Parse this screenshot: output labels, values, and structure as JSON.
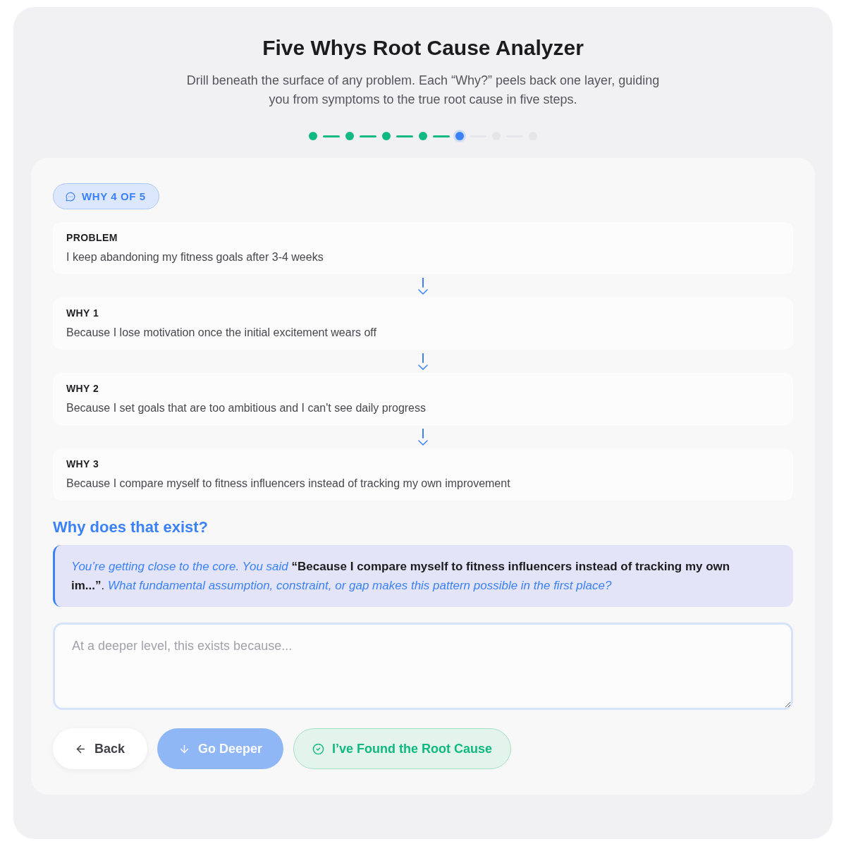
{
  "header": {
    "title": "Five Whys Root Cause Analyzer",
    "subtitle": "Drill beneath the surface of any problem. Each “Why?” peels back one layer, guiding you from symptoms to the true root cause in five steps."
  },
  "progress": {
    "steps": [
      {
        "completed": true,
        "current": false
      },
      {
        "completed": true,
        "current": false
      },
      {
        "completed": true,
        "current": false
      },
      {
        "completed": true,
        "current": false
      },
      {
        "completed": false,
        "current": true
      },
      {
        "completed": false,
        "current": false
      },
      {
        "completed": false,
        "current": false
      }
    ]
  },
  "badge": {
    "label": "WHY 4 OF 5"
  },
  "chain": [
    {
      "label": "PROBLEM",
      "text": "I keep abandoning my fitness goals after 3-4 weeks"
    },
    {
      "label": "WHY 1",
      "text": "Because I lose motivation once the initial excitement wears off"
    },
    {
      "label": "WHY 2",
      "text": "Because I set goals that are too ambitious and I can't see daily progress"
    },
    {
      "label": "WHY 3",
      "text": "Because I compare myself to fitness influencers instead of tracking my own improvement"
    }
  ],
  "question": {
    "heading": "Why does that exist?",
    "prompt": "*You’re getting close to the core. You said* **“Because I compare myself to fitness influencers instead of tracking my own im...”**. *What fundamental assumption, constraint, or gap makes this pattern possible in the first place?*"
  },
  "answer": {
    "placeholder": "At a deeper level, this exists because..."
  },
  "buttons": [
    {
      "kind": "back",
      "label": "Back",
      "disabled": false
    },
    {
      "kind": "deeper",
      "label": "Go Deeper",
      "disabled": true
    },
    {
      "kind": "found",
      "label": "I’ve Found the Root Cause",
      "disabled": false
    }
  ]
}
